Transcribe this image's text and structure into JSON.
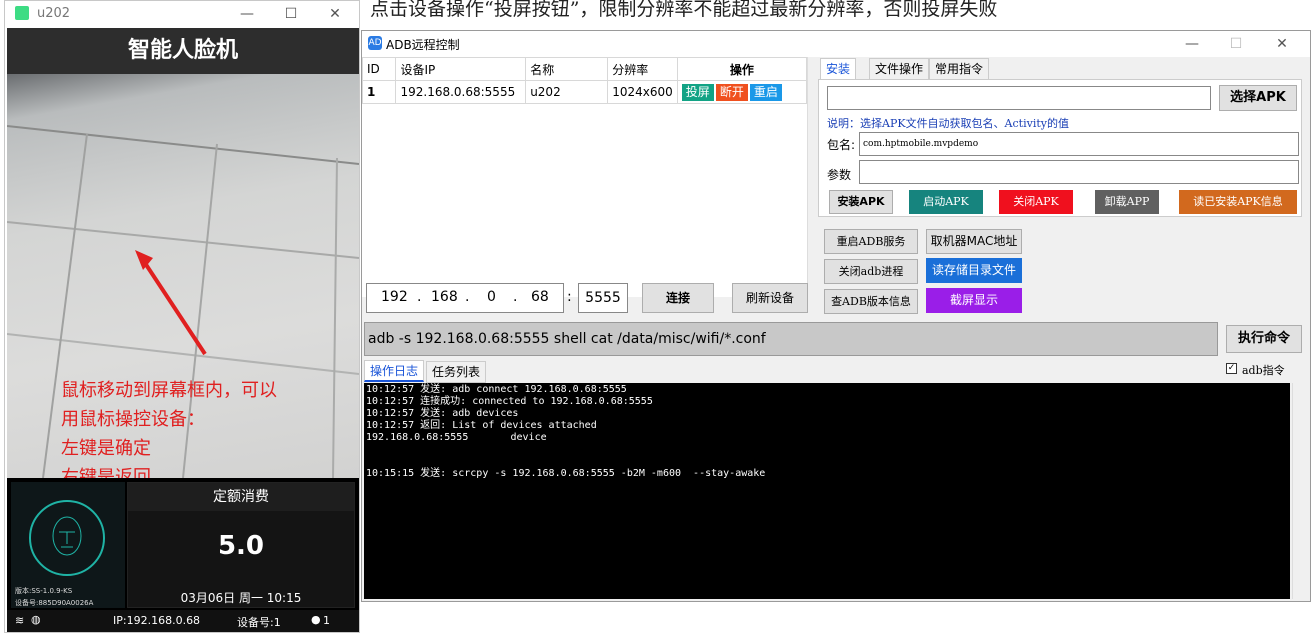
{
  "top_caption": "点击设备操作“投屏按钮”，限制分辨率不能超过最新分辨率，否则投屏失败",
  "scrcpy_window": {
    "title": "u202",
    "minimize": "—",
    "maximize": "☐",
    "close": "✕",
    "app_title": "智能人脸机",
    "annotation": [
      "鼠标移动到屏幕框内，可以",
      "用鼠标操控设备：",
      "左键是确定",
      "右键是返回"
    ],
    "version": "版本:SS-1.0.9-KS",
    "device_no": "设备号:885D90A0026A",
    "fee_title": "定额消费",
    "fee_amount": "5.0",
    "datetime": "03月06日 周一 10:15",
    "status_ip": "IP:192.168.0.68",
    "status_dev": "设备号:1",
    "status_users": "1"
  },
  "adb_window": {
    "title": "ADB远程控制",
    "icon": "AD",
    "minimize": "—",
    "maximize": "☐",
    "close": "✕",
    "table": {
      "headers": [
        "ID",
        "设备IP",
        "名称",
        "分辨率",
        "操作"
      ],
      "rows": [
        {
          "id": "1",
          "ip": "192.168.0.68:5555",
          "name": "u202",
          "res": "1024x600",
          "actions": [
            "投屏",
            "断开",
            "重启"
          ]
        }
      ]
    },
    "action_colors": [
      "#12a385",
      "#f0501e",
      "#1a98e8"
    ],
    "ip": [
      "192",
      "168",
      "0",
      "68"
    ],
    "ip_dot": ".",
    "port_sep": ":",
    "port": "5555",
    "connect_label": "连接",
    "refresh_label": "刷新设备",
    "tabs": [
      "安装",
      "文件操作",
      "常用指令"
    ],
    "select_apk": "选择APK",
    "hint": "说明：选择APK文件自动获取包名、Activity的值",
    "pkg_label": "包名:",
    "pkg_value": "com.hptmobile.mvpdemo",
    "param_label": "参数",
    "apk_buttons": [
      {
        "label": "安装APK",
        "color": "#e1e1e1"
      },
      {
        "label": "启动APK",
        "color": "#16847e"
      },
      {
        "label": "关闭APK",
        "color": "#f0101e"
      },
      {
        "label": "卸载APP",
        "color": "#606060"
      },
      {
        "label": "读已安装APK信息",
        "color": "#d2691e"
      }
    ],
    "service_buttons": {
      "restart_adb": "重启ADB服务",
      "mac": "取机器MAC地址",
      "kill_adb": "关闭adb进程",
      "read_storage": "读存储目录文件",
      "adb_version": "查ADB版本信息",
      "screenshot": "截屏显示"
    },
    "read_storage_color": "#1a6fd8",
    "screenshot_color": "#9a1ee8",
    "command": "adb -s 192.168.0.68:5555 shell cat /data/misc/wifi/*.conf",
    "execute_label": "执行命令",
    "log_tabs": [
      "操作日志",
      "任务列表"
    ],
    "adb_checkbox": "adb指令",
    "log_lines": [
      "10:12:57 发送: adb connect 192.168.0.68:5555",
      "10:12:57 连接成功: connected to 192.168.0.68:5555",
      "",
      "10:12:57 发送: adb devices",
      "10:12:57 返回: List of devices attached",
      "192.168.0.68:5555       device",
      "",
      "",
      "10:15:15 发送: scrcpy -s 192.168.0.68:5555 -b2M -m600  --stay-awake"
    ]
  }
}
